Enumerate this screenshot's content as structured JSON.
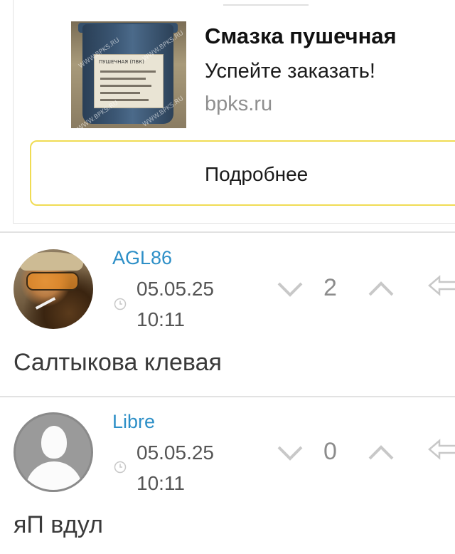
{
  "ad": {
    "title": "Смазка пушечная",
    "subtitle": "Успейте заказать!",
    "domain": "bpks.ru",
    "button_label": "Подробнее",
    "image_watermark": "WWW.BPKS.RU",
    "image_label": "ПУШЕЧНАЯ (ПВК)"
  },
  "comments": [
    {
      "username": "AGL86",
      "date": "05.05.25",
      "time": "10:11",
      "votes": "2",
      "text": "Салтыкова клевая",
      "avatar": "photo"
    },
    {
      "username": "Libre",
      "date": "05.05.25",
      "time": "10:11",
      "votes": "0",
      "text": "яП вдул",
      "avatar": "default-silhouette"
    }
  ],
  "colors": {
    "username": "#2d8fc7",
    "ad_button_border": "#f0dc54",
    "vote_count": "#8c8c8c",
    "icon_gray": "#c8c8c8"
  },
  "icons": {
    "vote_down": "chevron-down-icon",
    "vote_up": "chevron-up-icon",
    "reply": "reply-arrow-icon",
    "clock": "clock-icon"
  }
}
